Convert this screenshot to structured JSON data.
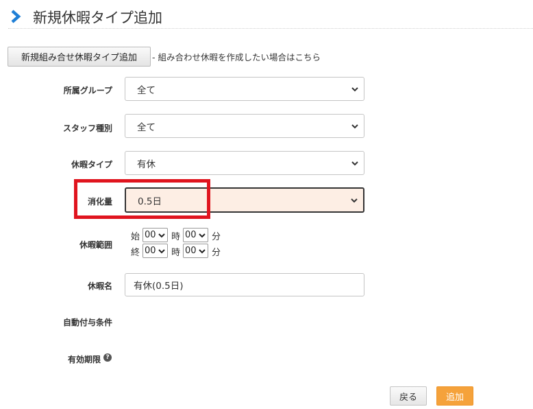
{
  "header": {
    "title": "新規休暇タイプ追加"
  },
  "combo": {
    "button_label": "新規組み合せ休暇タイプ追加",
    "note": "- 組み合わせ休暇を作成したい場合はこちら"
  },
  "form": {
    "group_label": "所属グループ",
    "group_value": "全て",
    "staff_type_label": "スタッフ種別",
    "staff_type_value": "全て",
    "leave_type_label": "休暇タイプ",
    "leave_type_value": "有休",
    "consumption_label": "消化量",
    "consumption_value": "0.5日",
    "range_label": "休暇範囲",
    "start_label": "始",
    "end_label": "終",
    "hour_label": "時",
    "minute_label": "分",
    "start_hour": "00",
    "start_minute": "00",
    "end_hour": "00",
    "end_minute": "00",
    "name_label": "休暇名",
    "name_value": "有休(0.5日)",
    "auto_grant_label": "自動付与条件",
    "expiry_label": "有効期限",
    "expiry_help_icon": "?"
  },
  "actions": {
    "back_label": "戻る",
    "add_label": "追加"
  },
  "colors": {
    "accent_blue": "#1f7fd6",
    "highlight_red": "#e0141e",
    "primary_orange": "#f5a23b",
    "active_field_bg": "#fdeee4"
  }
}
